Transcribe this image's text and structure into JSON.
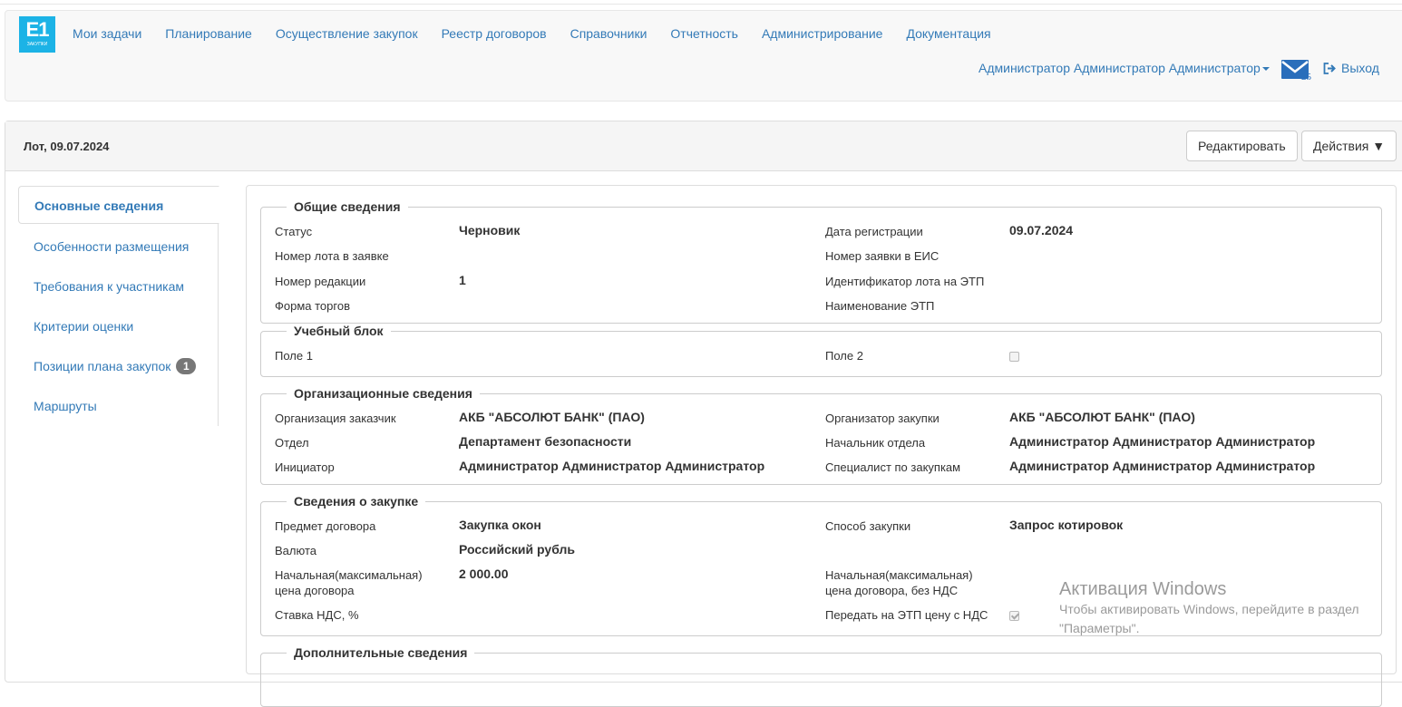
{
  "brand": {
    "logo_main": "E1",
    "logo_sub": "ЗАКУПКИ"
  },
  "nav": {
    "items": [
      "Мои задачи",
      "Планирование",
      "Осуществление закупок",
      "Реестр договоров",
      "Справочники",
      "Отчетность",
      "Администрирование",
      "Документация"
    ],
    "user": "Администратор Администратор Администратор",
    "mail_count": "25",
    "logout": "Выход"
  },
  "panel": {
    "title": "Лот, 09.07.2024",
    "edit_button": "Редактировать",
    "actions_button": "Действия ▼"
  },
  "sidebar": {
    "items": [
      {
        "label": "Основные сведения"
      },
      {
        "label": "Особенности размещения"
      },
      {
        "label": "Требования к участникам"
      },
      {
        "label": "Критерии оценки"
      },
      {
        "label": "Позиции плана закупок",
        "badge": "1"
      },
      {
        "label": "Маршруты"
      }
    ]
  },
  "general": {
    "legend": "Общие сведения",
    "status_label": "Статус",
    "status_value": "Черновик",
    "reg_date_label": "Дата регистрации",
    "reg_date_value": "09.07.2024",
    "lot_number_label": "Номер лота в заявке",
    "eis_number_label": "Номер заявки в ЕИС",
    "revision_label": "Номер редакции",
    "revision_value": "1",
    "etp_lot_id_label": "Идентификатор лота на ЭТП",
    "trade_form_label": "Форма торгов",
    "etp_name_label": "Наименование ЭТП"
  },
  "training": {
    "legend": "Учебный блок",
    "field1_label": "Поле 1",
    "field2_label": "Поле 2",
    "field2_checked": false
  },
  "org": {
    "legend": "Организационные сведения",
    "customer_label": "Организация заказчик",
    "customer_value": "АКБ \"АБСОЛЮТ БАНК\" (ПАО)",
    "organizer_label": "Организатор закупки",
    "organizer_value": "АКБ \"АБСОЛЮТ БАНК\" (ПАО)",
    "department_label": "Отдел",
    "department_value": "Департамент безопасности",
    "head_label": "Начальник отдела",
    "head_value": "Администратор Администратор Администратор",
    "initiator_label": "Инициатор",
    "initiator_value": "Администратор Администратор Администратор",
    "specialist_label": "Специалист по закупкам",
    "specialist_value": "Администратор Администратор Администратор"
  },
  "purchase": {
    "legend": "Сведения о закупке",
    "subject_label": "Предмет договора",
    "subject_value": "Закупка окон",
    "method_label": "Способ закупки",
    "method_value": "Запрос котировок",
    "currency_label": "Валюта",
    "currency_value": "Российский рубль",
    "nmc_label_1": "Начальная(максимальная)",
    "nmc_label_2": "цена договора",
    "nmc_value": "2 000.00",
    "nmc_novat_label_1": "Начальная(максимальная)",
    "nmc_novat_label_2": "цена договора, без НДС",
    "vat_label": "Ставка НДС, %",
    "send_vat_label": "Передать на ЭТП цену с НДС",
    "send_vat_checked": true
  },
  "additional": {
    "legend": "Дополнительные сведения"
  },
  "watermark": {
    "title": "Активация Windows",
    "line1": "Чтобы активировать Windows, перейдите в раздел",
    "line2": "\"Параметры\"."
  }
}
